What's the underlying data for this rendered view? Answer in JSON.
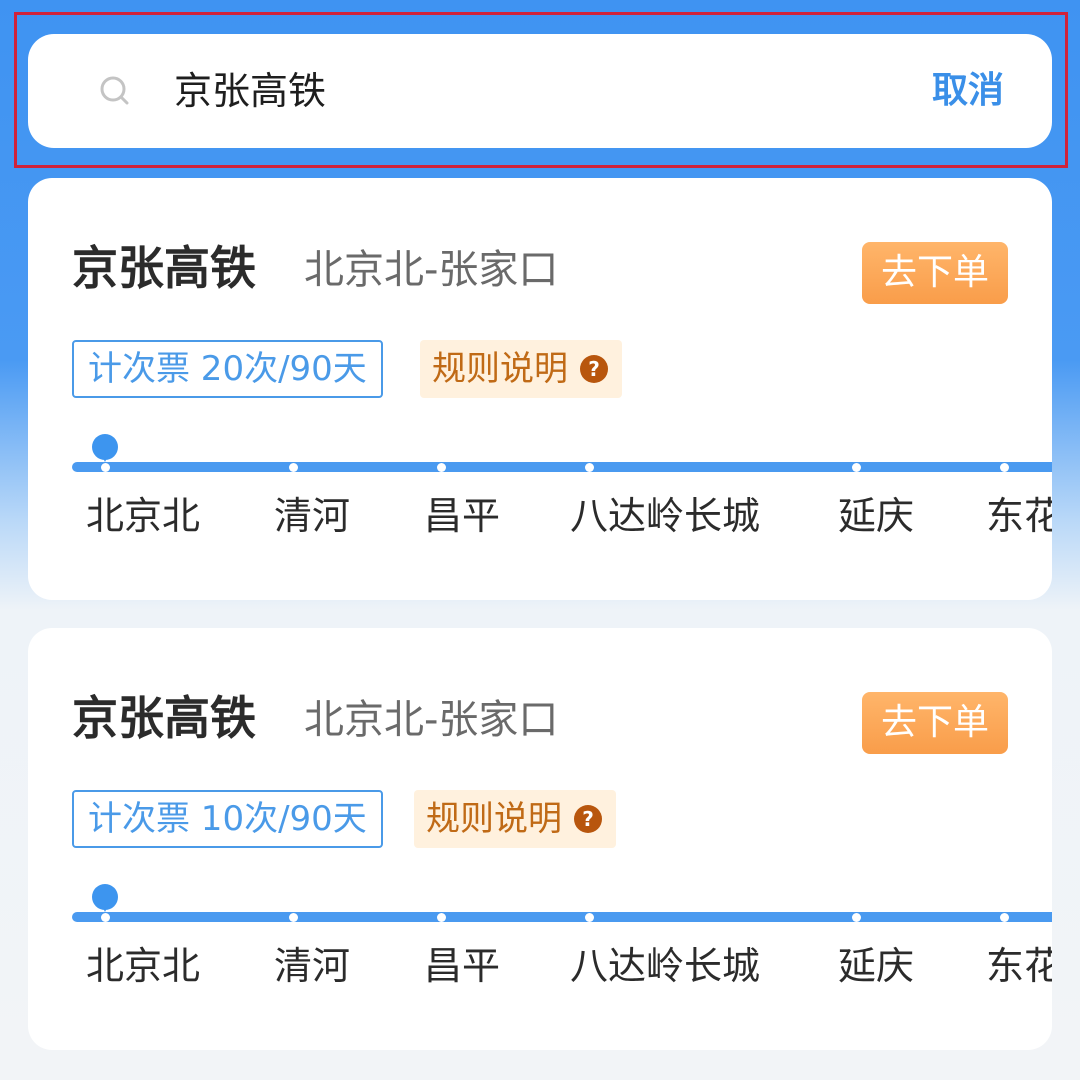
{
  "search": {
    "query": "京张高铁",
    "cancel_label": "取消"
  },
  "cards": [
    {
      "title": "京张高铁",
      "route": "北京北-张家口",
      "order_label": "去下单",
      "ticket_tag": "计次票 20次/90天",
      "rules_label": "规则说明",
      "help_glyph": "?",
      "stations": [
        "北京北",
        "清河",
        "昌平",
        "八达岭长城",
        "延庆",
        "东花"
      ]
    },
    {
      "title": "京张高铁",
      "route": "北京北-张家口",
      "order_label": "去下单",
      "ticket_tag": "计次票 10次/90天",
      "rules_label": "规则说明",
      "help_glyph": "?",
      "stations": [
        "北京北",
        "清河",
        "昌平",
        "八达岭长城",
        "延庆",
        "东花"
      ]
    }
  ],
  "colors": {
    "accent_blue": "#4a9af0",
    "order_orange": "#f99d4a",
    "rules_bg": "#fff1de",
    "highlight_border": "#d0223a"
  }
}
